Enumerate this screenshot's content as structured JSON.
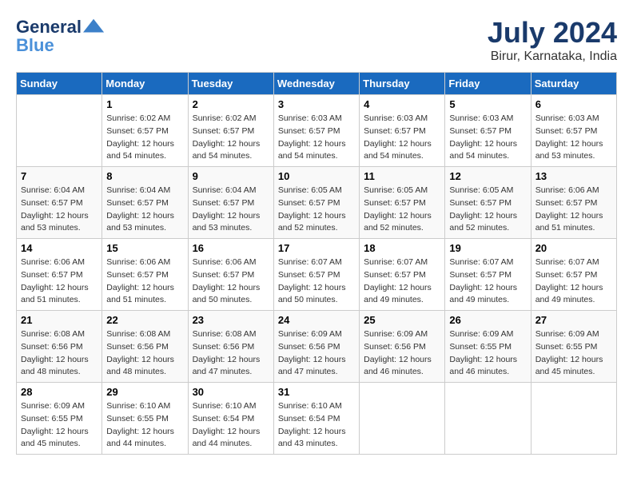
{
  "header": {
    "logo_main": "General",
    "logo_accent": "Blue",
    "month_year": "July 2024",
    "location": "Birur, Karnataka, India"
  },
  "days_of_week": [
    "Sunday",
    "Monday",
    "Tuesday",
    "Wednesday",
    "Thursday",
    "Friday",
    "Saturday"
  ],
  "weeks": [
    [
      {
        "day": "",
        "info": []
      },
      {
        "day": "1",
        "info": [
          "Sunrise: 6:02 AM",
          "Sunset: 6:57 PM",
          "Daylight: 12 hours",
          "and 54 minutes."
        ]
      },
      {
        "day": "2",
        "info": [
          "Sunrise: 6:02 AM",
          "Sunset: 6:57 PM",
          "Daylight: 12 hours",
          "and 54 minutes."
        ]
      },
      {
        "day": "3",
        "info": [
          "Sunrise: 6:03 AM",
          "Sunset: 6:57 PM",
          "Daylight: 12 hours",
          "and 54 minutes."
        ]
      },
      {
        "day": "4",
        "info": [
          "Sunrise: 6:03 AM",
          "Sunset: 6:57 PM",
          "Daylight: 12 hours",
          "and 54 minutes."
        ]
      },
      {
        "day": "5",
        "info": [
          "Sunrise: 6:03 AM",
          "Sunset: 6:57 PM",
          "Daylight: 12 hours",
          "and 54 minutes."
        ]
      },
      {
        "day": "6",
        "info": [
          "Sunrise: 6:03 AM",
          "Sunset: 6:57 PM",
          "Daylight: 12 hours",
          "and 53 minutes."
        ]
      }
    ],
    [
      {
        "day": "7",
        "info": [
          "Sunrise: 6:04 AM",
          "Sunset: 6:57 PM",
          "Daylight: 12 hours",
          "and 53 minutes."
        ]
      },
      {
        "day": "8",
        "info": [
          "Sunrise: 6:04 AM",
          "Sunset: 6:57 PM",
          "Daylight: 12 hours",
          "and 53 minutes."
        ]
      },
      {
        "day": "9",
        "info": [
          "Sunrise: 6:04 AM",
          "Sunset: 6:57 PM",
          "Daylight: 12 hours",
          "and 53 minutes."
        ]
      },
      {
        "day": "10",
        "info": [
          "Sunrise: 6:05 AM",
          "Sunset: 6:57 PM",
          "Daylight: 12 hours",
          "and 52 minutes."
        ]
      },
      {
        "day": "11",
        "info": [
          "Sunrise: 6:05 AM",
          "Sunset: 6:57 PM",
          "Daylight: 12 hours",
          "and 52 minutes."
        ]
      },
      {
        "day": "12",
        "info": [
          "Sunrise: 6:05 AM",
          "Sunset: 6:57 PM",
          "Daylight: 12 hours",
          "and 52 minutes."
        ]
      },
      {
        "day": "13",
        "info": [
          "Sunrise: 6:06 AM",
          "Sunset: 6:57 PM",
          "Daylight: 12 hours",
          "and 51 minutes."
        ]
      }
    ],
    [
      {
        "day": "14",
        "info": [
          "Sunrise: 6:06 AM",
          "Sunset: 6:57 PM",
          "Daylight: 12 hours",
          "and 51 minutes."
        ]
      },
      {
        "day": "15",
        "info": [
          "Sunrise: 6:06 AM",
          "Sunset: 6:57 PM",
          "Daylight: 12 hours",
          "and 51 minutes."
        ]
      },
      {
        "day": "16",
        "info": [
          "Sunrise: 6:06 AM",
          "Sunset: 6:57 PM",
          "Daylight: 12 hours",
          "and 50 minutes."
        ]
      },
      {
        "day": "17",
        "info": [
          "Sunrise: 6:07 AM",
          "Sunset: 6:57 PM",
          "Daylight: 12 hours",
          "and 50 minutes."
        ]
      },
      {
        "day": "18",
        "info": [
          "Sunrise: 6:07 AM",
          "Sunset: 6:57 PM",
          "Daylight: 12 hours",
          "and 49 minutes."
        ]
      },
      {
        "day": "19",
        "info": [
          "Sunrise: 6:07 AM",
          "Sunset: 6:57 PM",
          "Daylight: 12 hours",
          "and 49 minutes."
        ]
      },
      {
        "day": "20",
        "info": [
          "Sunrise: 6:07 AM",
          "Sunset: 6:57 PM",
          "Daylight: 12 hours",
          "and 49 minutes."
        ]
      }
    ],
    [
      {
        "day": "21",
        "info": [
          "Sunrise: 6:08 AM",
          "Sunset: 6:56 PM",
          "Daylight: 12 hours",
          "and 48 minutes."
        ]
      },
      {
        "day": "22",
        "info": [
          "Sunrise: 6:08 AM",
          "Sunset: 6:56 PM",
          "Daylight: 12 hours",
          "and 48 minutes."
        ]
      },
      {
        "day": "23",
        "info": [
          "Sunrise: 6:08 AM",
          "Sunset: 6:56 PM",
          "Daylight: 12 hours",
          "and 47 minutes."
        ]
      },
      {
        "day": "24",
        "info": [
          "Sunrise: 6:09 AM",
          "Sunset: 6:56 PM",
          "Daylight: 12 hours",
          "and 47 minutes."
        ]
      },
      {
        "day": "25",
        "info": [
          "Sunrise: 6:09 AM",
          "Sunset: 6:56 PM",
          "Daylight: 12 hours",
          "and 46 minutes."
        ]
      },
      {
        "day": "26",
        "info": [
          "Sunrise: 6:09 AM",
          "Sunset: 6:55 PM",
          "Daylight: 12 hours",
          "and 46 minutes."
        ]
      },
      {
        "day": "27",
        "info": [
          "Sunrise: 6:09 AM",
          "Sunset: 6:55 PM",
          "Daylight: 12 hours",
          "and 45 minutes."
        ]
      }
    ],
    [
      {
        "day": "28",
        "info": [
          "Sunrise: 6:09 AM",
          "Sunset: 6:55 PM",
          "Daylight: 12 hours",
          "and 45 minutes."
        ]
      },
      {
        "day": "29",
        "info": [
          "Sunrise: 6:10 AM",
          "Sunset: 6:55 PM",
          "Daylight: 12 hours",
          "and 44 minutes."
        ]
      },
      {
        "day": "30",
        "info": [
          "Sunrise: 6:10 AM",
          "Sunset: 6:54 PM",
          "Daylight: 12 hours",
          "and 44 minutes."
        ]
      },
      {
        "day": "31",
        "info": [
          "Sunrise: 6:10 AM",
          "Sunset: 6:54 PM",
          "Daylight: 12 hours",
          "and 43 minutes."
        ]
      },
      {
        "day": "",
        "info": []
      },
      {
        "day": "",
        "info": []
      },
      {
        "day": "",
        "info": []
      }
    ]
  ]
}
